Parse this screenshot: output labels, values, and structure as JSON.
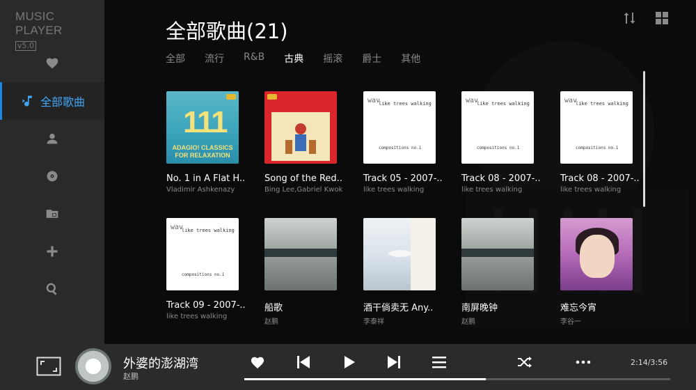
{
  "app": {
    "name": "MUSIC PLAYER",
    "version": "v5.0"
  },
  "sidebar": {
    "active_label": "全部歌曲",
    "items": [
      {
        "icon": "heart-icon"
      },
      {
        "icon": "music-note-icon",
        "label": "全部歌曲"
      },
      {
        "icon": "person-icon"
      },
      {
        "icon": "disc-icon"
      },
      {
        "icon": "folder-icon"
      },
      {
        "icon": "plus-icon"
      },
      {
        "icon": "search-icon"
      }
    ]
  },
  "main": {
    "title": "全部歌曲(21)",
    "tabs": [
      {
        "label": "全部"
      },
      {
        "label": "流行"
      },
      {
        "label": "R&B"
      },
      {
        "label": "古典",
        "active": true
      },
      {
        "label": "摇滚"
      },
      {
        "label": "爵士"
      },
      {
        "label": "其他"
      }
    ],
    "songs": [
      {
        "title": "No. 1 in A Flat H..",
        "artist": "Vladimir Ashkenazy",
        "cover": "teal",
        "cover_text": "111",
        "cover_sub": "ADAGIO! CLASSICS FOR RELAXATION"
      },
      {
        "title": "Song of the Red..",
        "artist": "Bing Lee,Gabriel Kwok",
        "cover": "red"
      },
      {
        "title": "Track 05 - 2007-..",
        "artist": "like trees walking",
        "cover": "white"
      },
      {
        "title": "Track 08 - 2007-..",
        "artist": "like trees walking",
        "cover": "white"
      },
      {
        "title": "Track 08 - 2007-..",
        "artist": "like trees walking",
        "cover": "white"
      },
      {
        "title": "Track 09 - 2007-..",
        "artist": "like trees walking",
        "cover": "white"
      },
      {
        "title": "船歌",
        "artist": "赵鹏",
        "cover": "gray"
      },
      {
        "title": "酒干倘卖无 Any..",
        "artist": "李泰祥",
        "cover": "sky"
      },
      {
        "title": "南屏晚钟",
        "artist": "赵鹏",
        "cover": "gray"
      },
      {
        "title": "难忘今宵",
        "artist": "李谷一",
        "cover": "purple"
      }
    ],
    "white_cover": {
      "wav": "wav",
      "line1": "like trees walking",
      "line2": "compositions no.1"
    }
  },
  "player": {
    "title": "外婆的澎湖湾",
    "artist": "赵鹏",
    "time": "2:14/3:56",
    "progress": 0.567,
    "accent": "#1e88e5"
  }
}
